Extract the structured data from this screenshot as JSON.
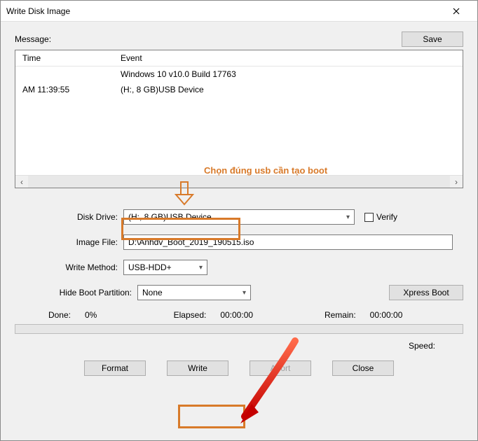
{
  "window": {
    "title": "Write Disk Image"
  },
  "labels": {
    "message": "Message:",
    "save": "Save",
    "col_time": "Time",
    "col_event": "Event",
    "disk_drive": "Disk Drive:",
    "verify": "Verify",
    "image_file": "Image File:",
    "write_method": "Write Method:",
    "hide_boot": "Hide Boot Partition:",
    "xpress_boot": "Xpress Boot",
    "done": "Done:",
    "elapsed": "Elapsed:",
    "remain": "Remain:",
    "speed": "Speed:",
    "format": "Format",
    "write": "Write",
    "abort": "Abort",
    "close": "Close"
  },
  "log": {
    "rows": [
      {
        "time": "",
        "event": "Windows 10 v10.0 Build 17763"
      },
      {
        "time": "AM 11:39:55",
        "event": "(H:, 8 GB)USB Device"
      }
    ]
  },
  "fields": {
    "disk_drive": "(H:, 8 GB)USB Device",
    "image_file": "D:\\Anhdv_Boot_2019_190515.iso",
    "write_method": "USB-HDD+",
    "hide_boot": "None"
  },
  "status": {
    "done": "0%",
    "elapsed": "00:00:00",
    "remain": "00:00:00"
  },
  "annotation": {
    "text": "Chọn đúng usb cần tạo boot"
  }
}
